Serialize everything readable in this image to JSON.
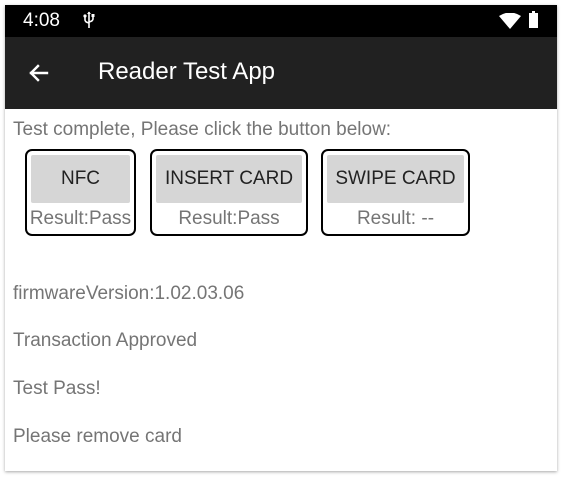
{
  "status_bar": {
    "time": "4:08",
    "icons": [
      "usb-icon",
      "wifi-icon",
      "battery-icon"
    ]
  },
  "app_bar": {
    "title": "Reader Test App",
    "back_icon": "arrow-back-icon"
  },
  "main": {
    "instruction": "Test complete, Please click the button below:",
    "cards": [
      {
        "button_label": "NFC",
        "result": "Result:Pass"
      },
      {
        "button_label": "INSERT CARD",
        "result": "Result:Pass"
      },
      {
        "button_label": "SWIPE CARD",
        "result": "Result: --"
      }
    ],
    "firmware": "firmwareVersion:1.02.03.06",
    "transaction_status": "Transaction Approved",
    "test_status": "Test Pass!",
    "prompt": "Please remove card"
  },
  "colors": {
    "status_bar_bg": "#000000",
    "app_bar_bg": "#212121",
    "button_bg": "#d6d6d6",
    "text_gray": "#757575"
  }
}
